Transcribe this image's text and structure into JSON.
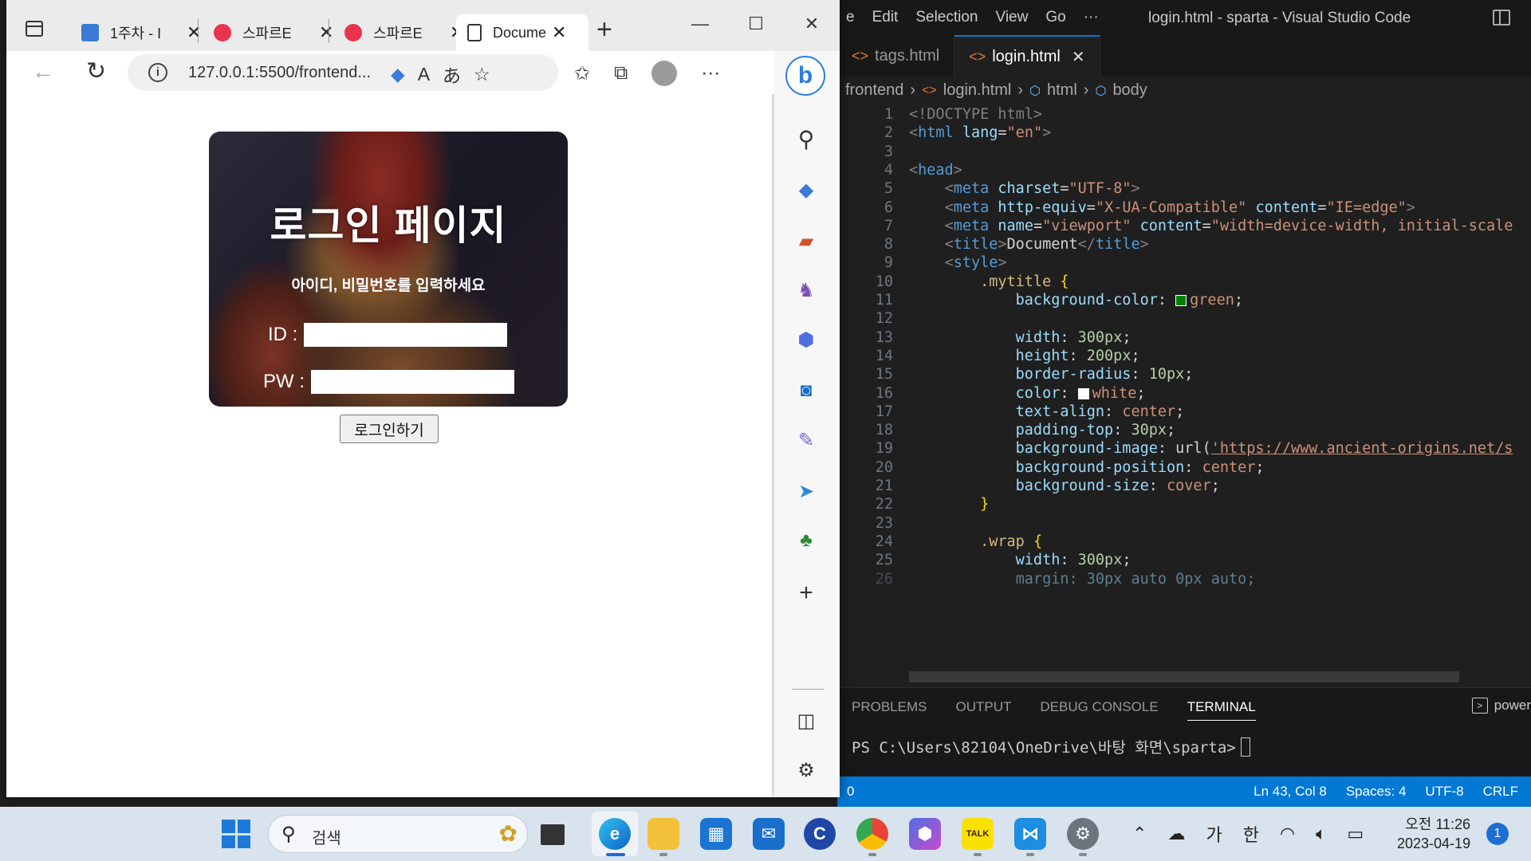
{
  "vscode": {
    "menus": [
      "e",
      "Edit",
      "Selection",
      "View",
      "Go",
      "···"
    ],
    "window_title": "login.html - sparta - Visual Studio Code",
    "tabs": [
      {
        "label": "tags.html",
        "active": false
      },
      {
        "label": "login.html",
        "active": true
      }
    ],
    "breadcrumb": [
      "frontend",
      "login.html",
      "html",
      "body"
    ],
    "lines": [
      {
        "n": "1"
      },
      {
        "n": "2"
      },
      {
        "n": "3"
      },
      {
        "n": "4"
      },
      {
        "n": "5"
      },
      {
        "n": "6"
      },
      {
        "n": "7"
      },
      {
        "n": "8"
      },
      {
        "n": "9"
      },
      {
        "n": "10"
      },
      {
        "n": "11"
      },
      {
        "n": "12"
      },
      {
        "n": "13"
      },
      {
        "n": "14"
      },
      {
        "n": "15"
      },
      {
        "n": "16"
      },
      {
        "n": "17"
      },
      {
        "n": "18"
      },
      {
        "n": "19"
      },
      {
        "n": "20"
      },
      {
        "n": "21"
      },
      {
        "n": "22"
      },
      {
        "n": "23"
      },
      {
        "n": "24"
      },
      {
        "n": "25"
      },
      {
        "n": "26"
      }
    ],
    "code": {
      "l1": "<!DOCTYPE html>",
      "l2_tag": "html",
      "l2_attr": "lang",
      "l2_val": "\"en\"",
      "l4_tag": "head",
      "l5_attr": "charset",
      "l5_val": "\"UTF-8\"",
      "l6_attr1": "http-equiv",
      "l6_val1": "\"X-UA-Compatible\"",
      "l6_attr2": "content",
      "l6_val2": "\"IE=edge\"",
      "l7_attr1": "name",
      "l7_val1": "\"viewport\"",
      "l7_attr2": "content",
      "l7_val2": "\"width=device-width, initial-scale",
      "l8_text": "Document",
      "l9_tag": "style",
      "l10_sel": ".mytitle",
      "l11_prop": "background-color",
      "l11_val": "green",
      "l13_prop": "width",
      "l13_val": "300px",
      "l14_prop": "height",
      "l14_val": "200px",
      "l15_prop": "border-radius",
      "l15_val": "10px",
      "l16_prop": "color",
      "l16_val": "white",
      "l17_prop": "text-align",
      "l17_val": "center",
      "l18_prop": "padding-top",
      "l18_val": "30px",
      "l19_prop": "background-image",
      "l19_fn": "url(",
      "l19_val": "'https://www.ancient-origins.net/s",
      "l20_prop": "background-position",
      "l20_val": "center",
      "l21_prop": "background-size",
      "l21_val": "cover",
      "l24_sel": ".wrap",
      "l25_prop": "width",
      "l25_val": "300px",
      "l26_text": "margin: 30px auto 0px auto;"
    },
    "panel_tabs": [
      "PROBLEMS",
      "OUTPUT",
      "DEBUG CONSOLE",
      "TERMINAL"
    ],
    "panel_right": "power",
    "terminal_prompt": "PS C:\\Users\\82104\\OneDrive\\바탕 화면\\sparta>",
    "status": {
      "left": "0",
      "position": "Ln 43, Col 8",
      "spaces": "Spaces: 4",
      "encoding": "UTF-8",
      "eol": "CRLF"
    },
    "colors": {
      "status_bar": "#0078d4",
      "editor_bg": "#1f1f1f",
      "swatch_green": "#008000",
      "swatch_white": "#ffffff"
    }
  },
  "browser": {
    "tabs": [
      {
        "title": "1주차 - I",
        "favicon": "notion-book-icon",
        "active": false
      },
      {
        "title": "스파르E",
        "favicon": "sparta-heart-icon",
        "active": false
      },
      {
        "title": "스파르E",
        "favicon": "sparta-heart-icon",
        "active": false
      },
      {
        "title": "Docume",
        "favicon": "document-icon",
        "active": true
      }
    ],
    "url": "127.0.0.1:5500/frontend...",
    "page": {
      "title": "로그인 페이지",
      "subtitle": "아이디, 비밀번호를 입력하세요",
      "id_label": "ID :",
      "pw_label": "PW :",
      "login_button": "로그인하기",
      "id_value": "",
      "pw_value": ""
    },
    "sidebar_icons": [
      "search-icon",
      "shopping-tag-icon",
      "tools-briefcase-icon",
      "games-icon",
      "microsoft-365-icon",
      "outlook-icon",
      "drop-edit-icon",
      "send-icon",
      "tree-icon",
      "add-icon",
      "split-screen-icon",
      "settings-gear-icon"
    ]
  },
  "taskbar": {
    "search_placeholder": "검색",
    "apps": [
      "task-view-icon",
      "edge-icon",
      "file-explorer-icon",
      "microsoft-store-icon",
      "mail-icon",
      "edge-canary-icon",
      "chrome-icon",
      "copilot-icon",
      "kakaotalk-icon",
      "vscode-icon",
      "settings-icon"
    ],
    "kakao_label": "TALK",
    "tray": {
      "ime1": "가",
      "ime2": "한"
    },
    "clock": {
      "time": "오전 11:26",
      "date": "2023-04-19"
    },
    "notification_count": "1"
  }
}
